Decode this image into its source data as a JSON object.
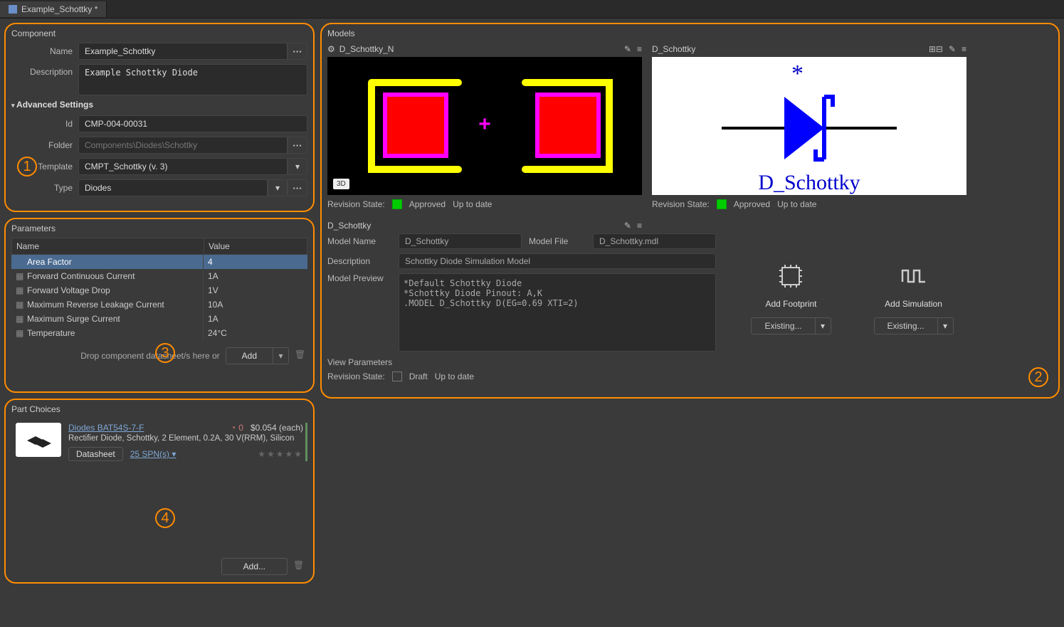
{
  "tab": {
    "title": "Example_Schottky *"
  },
  "component": {
    "panel_title": "Component",
    "name_label": "Name",
    "name_value": "Example_Schottky",
    "desc_label": "Description",
    "desc_value": "Example Schottky Diode",
    "adv_header": "Advanced Settings",
    "id_label": "Id",
    "id_value": "CMP-004-00031",
    "folder_label": "Folder",
    "folder_value": "Components\\Diodes\\Schottky",
    "template_label": "Template",
    "template_value": "CMPT_Schottky (v. 3)",
    "type_label": "Type",
    "type_value": "Diodes"
  },
  "parameters": {
    "panel_title": "Parameters",
    "col_name": "Name",
    "col_value": "Value",
    "rows": [
      {
        "name": "Area Factor",
        "value": "4",
        "selected": true
      },
      {
        "name": "Forward Continuous Current",
        "value": "1A"
      },
      {
        "name": "Forward Voltage Drop",
        "value": "1V"
      },
      {
        "name": "Maximum Reverse Leakage Current",
        "value": "10A"
      },
      {
        "name": "Maximum Surge Current",
        "value": "1A"
      },
      {
        "name": "Temperature",
        "value": "24°C"
      }
    ],
    "drop_hint": "Drop component datasheet/s here or",
    "add_btn": "Add"
  },
  "part_choices": {
    "panel_title": "Part Choices",
    "part_link": "Diodes BAT54S-7-F",
    "part_desc": "Rectifier Diode, Schottky, 2 Element, 0.2A, 30 V(RRM), Silicon",
    "datasheet_btn": "Datasheet",
    "spn": "25 SPN(s)",
    "stock_zero": "0",
    "price": "$0.054 (each)",
    "add_btn": "Add..."
  },
  "models": {
    "panel_title": "Models",
    "footprint_name": "D_Schottky_N",
    "symbol_name": "D_Schottky",
    "rev_state_label": "Revision State:",
    "approved": "Approved",
    "uptodate": "Up to date",
    "draft": "Draft",
    "three_d": "3D",
    "sim": {
      "title": "D_Schottky",
      "model_name_label": "Model Name",
      "model_name_value": "D_Schottky",
      "model_file_label": "Model File",
      "model_file_value": "D_Schottky.mdl",
      "desc_label": "Description",
      "desc_value": "Schottky Diode Simulation Model",
      "preview_label": "Model Preview",
      "preview_text": "*Default Schottky Diode\n*Schottky Diode Pinout: A,K\n.MODEL D_Schottky D(EG=0.69 XTI=2)",
      "view_params": "View Parameters"
    },
    "add_footprint": "Add Footprint",
    "add_simulation": "Add Simulation",
    "existing": "Existing..."
  },
  "badges": {
    "one": "1",
    "two": "2",
    "three": "3",
    "four": "4"
  }
}
